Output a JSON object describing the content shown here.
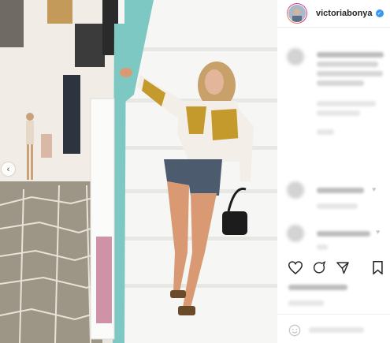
{
  "post": {
    "username": "victoriabonya",
    "verified_badge": "✓",
    "nav_prev_glyph": "‹"
  },
  "icons": {
    "like": "heart-icon",
    "comment": "comment-icon",
    "share": "send-icon",
    "save": "bookmark-icon",
    "emoji": "emoji-icon",
    "prev": "chevron-left-icon"
  },
  "colors": {
    "railing": "#7ec8c4",
    "verified": "#3897f0",
    "username": "#262626"
  }
}
